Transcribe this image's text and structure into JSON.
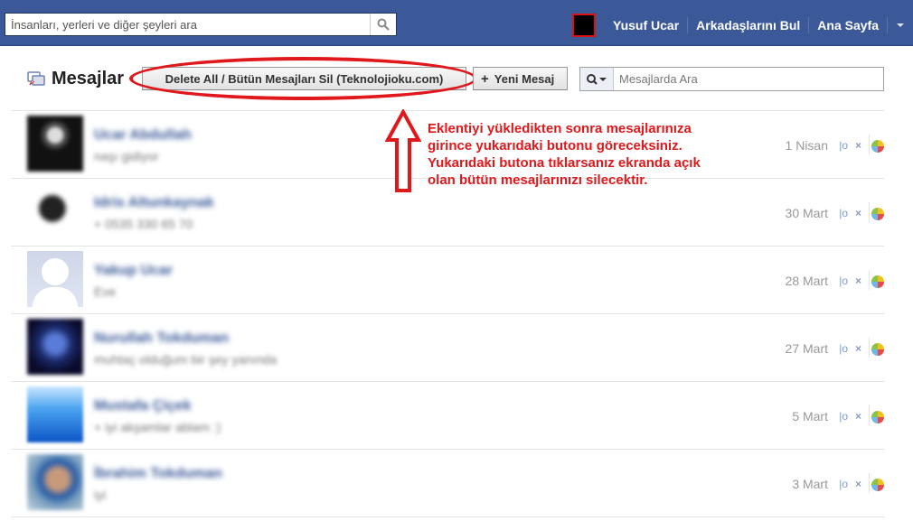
{
  "topbar": {
    "search_placeholder": "İnsanları, yerleri ve diğer şeyleri ara",
    "nav": [
      "Yusuf Ucar",
      "Arkadaşlarını Bul",
      "Ana Sayfa"
    ]
  },
  "messages_header": {
    "title": "Mesajlar",
    "delete_all_label": "Delete All / Bütün Mesajları Sil (Teknolojioku.com)",
    "new_message_label": "Yeni Mesaj",
    "search_placeholder": "Mesajlarda Ara"
  },
  "annotation": {
    "lines": [
      "Eklentiyi yükledikten sonra mesajlarınıza",
      "girince yukarıdaki butonu göreceksiniz.",
      "Yukarıdaki butona tıklarsanız ekranda açık",
      "olan bütün mesajlarınızı silecektir."
    ],
    "color": "#e0181b"
  },
  "threads": [
    {
      "name": "Ucar Abdullah",
      "snippet": "naşı gidiyor",
      "date": "1 Nisan"
    },
    {
      "name": "Idris Altunkaynak",
      "snippet": "+ 0535 330 65 70",
      "date": "30 Mart"
    },
    {
      "name": "Yakup Ucar",
      "snippet": "Eve",
      "date": "28 Mart"
    },
    {
      "name": "Nurullah Tokduman",
      "snippet": "muhtaç olduğum bir şey yanında",
      "date": "27 Mart"
    },
    {
      "name": "Mustafa Çiçek",
      "snippet": "+ iyi akşamlar ablam :)",
      "date": "5 Mart"
    },
    {
      "name": "İbrahim Tokduman",
      "snippet": "iyi",
      "date": "3 Mart"
    }
  ],
  "colors": {
    "topbar": "#3b5998",
    "link": "#3b5998",
    "highlight": "#e0181b"
  },
  "icons": [
    "search-icon",
    "messages-icon",
    "plus-icon",
    "magnifier-dropdown-icon",
    "mark-read-icon",
    "delete-x-icon",
    "report-icon",
    "caret-down-icon"
  ]
}
